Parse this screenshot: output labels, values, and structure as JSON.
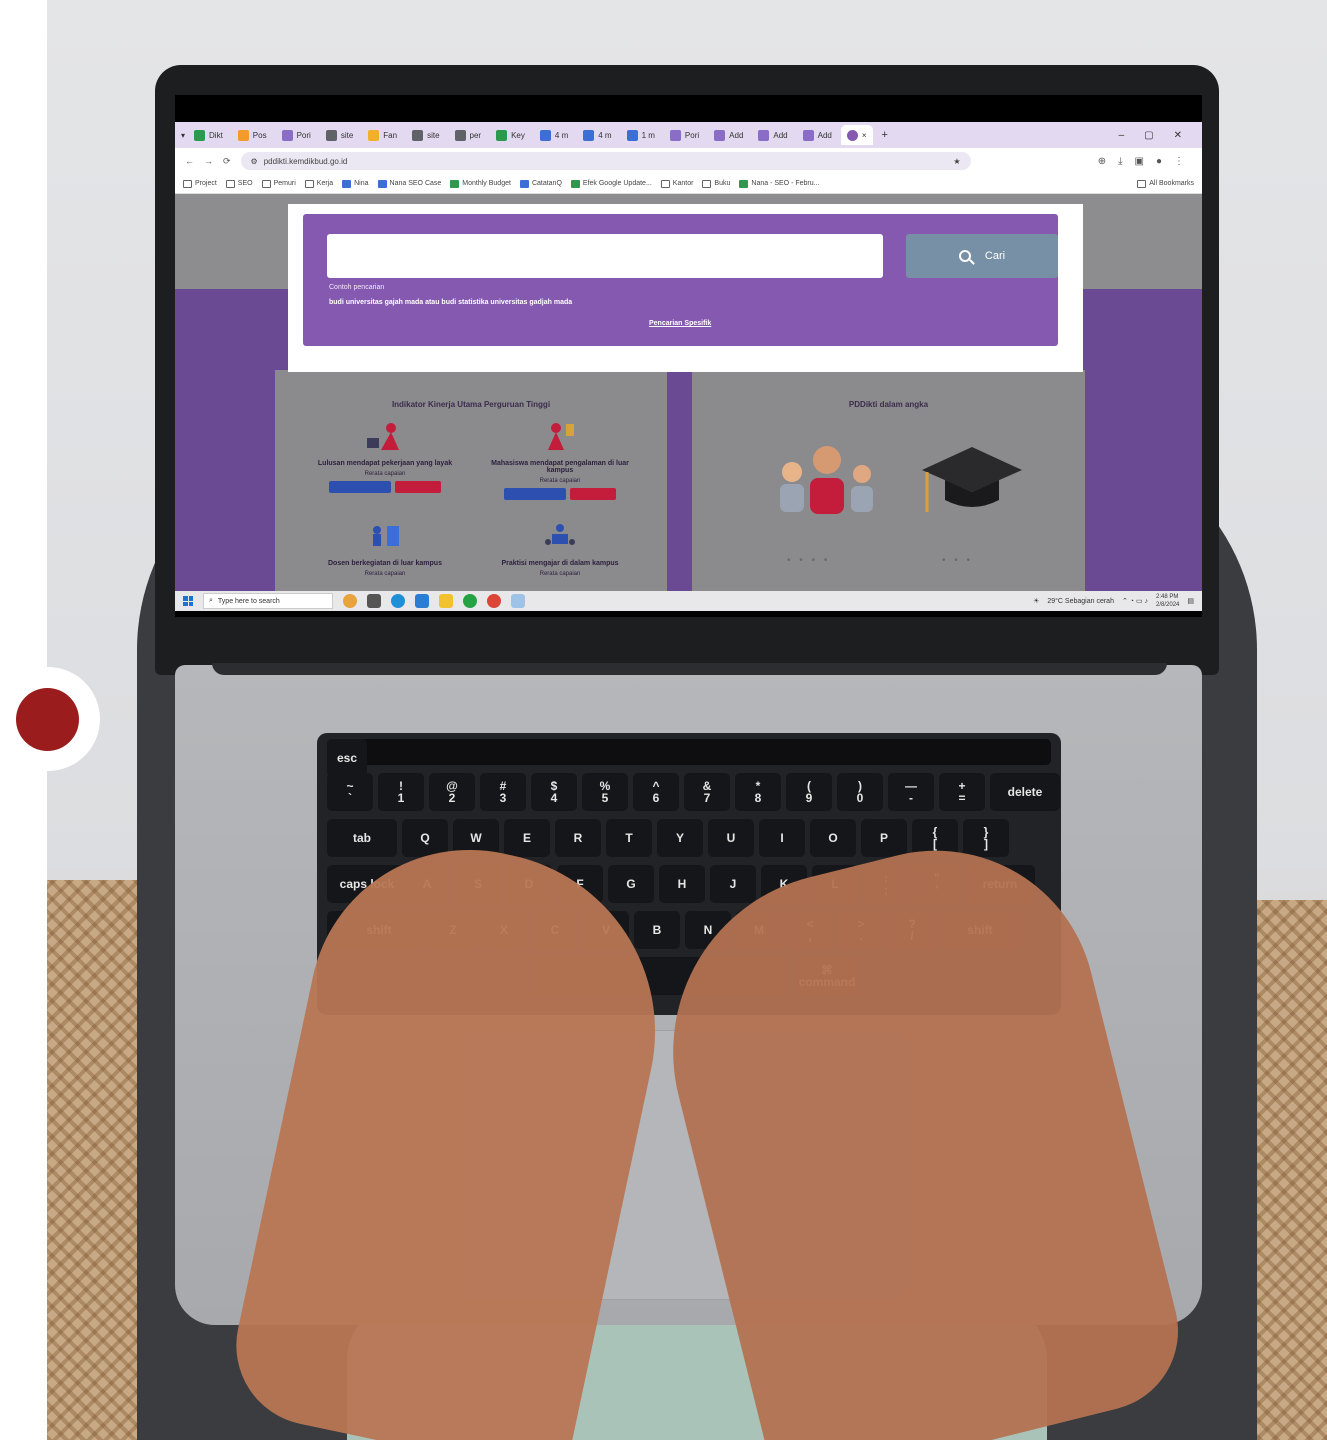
{
  "browser": {
    "tabs": [
      {
        "label": "Dikt",
        "color": "#2c9a4c"
      },
      {
        "label": "Pos",
        "color": "#f29a2a"
      },
      {
        "label": "Pori",
        "color": "#8a6dc6"
      },
      {
        "label": "site",
        "color": "#5f6368"
      },
      {
        "label": "Fan",
        "color": "#f2b02a"
      },
      {
        "label": "site",
        "color": "#5f6368"
      },
      {
        "label": "per",
        "color": "#5f6368"
      },
      {
        "label": "Key",
        "color": "#2c9a4c"
      },
      {
        "label": "4 m",
        "color": "#3b6fd6"
      },
      {
        "label": "4 m",
        "color": "#3b6fd6"
      },
      {
        "label": "1 m",
        "color": "#3b6fd6"
      },
      {
        "label": "Pori",
        "color": "#8a6dc6"
      },
      {
        "label": "Add",
        "color": "#8a6dc6"
      },
      {
        "label": "Add",
        "color": "#8a6dc6"
      },
      {
        "label": "Add",
        "color": "#8a6dc6"
      }
    ],
    "new_tab": "+",
    "close_tab": "×",
    "window_controls": [
      "–",
      "▢",
      "✕"
    ],
    "url": "pddikti.kemdikbud.go.id",
    "bookmarks": [
      "Project",
      "SEO",
      "Pemuri",
      "Kerja",
      "Nina",
      "Nana SEO Case",
      "Monthly Budget",
      "CatatanQ",
      "Efek Google Update...",
      "Kantor",
      "Buku",
      "Nana - SEO - Febru..."
    ],
    "all_bookmarks": "All Bookmarks"
  },
  "search": {
    "placeholder": "",
    "button_label": "Cari",
    "example_label": "Contoh pencarian",
    "example_text": "budi universitas gajah mada atau budi statistika universitas gadjah mada",
    "specific_link": "Pencarian Spesifik"
  },
  "cards": {
    "left_title": "Indikator Kinerja Utama Perguruan Tinggi",
    "right_title": "PDDikti dalam angka",
    "indicators": [
      {
        "title": "Lulusan mendapat pekerjaan yang layak",
        "sub": "Rerata capaian"
      },
      {
        "title": "Mahasiswa mendapat pengalaman di luar kampus",
        "sub": "Rerata capaian"
      },
      {
        "title": "Dosen berkegiatan di luar kampus",
        "sub": "Rerata capaian"
      },
      {
        "title": "Praktisi mengajar di dalam kampus",
        "sub": "Rerata capaian"
      }
    ]
  },
  "taskbar": {
    "search_placeholder": "Type here to search",
    "weather": "29°C  Sebagian cerah",
    "time": "2:48 PM",
    "date": "2/8/2024"
  },
  "keyboard": {
    "row1": [
      "~\n`",
      "!\n1",
      "@\n2",
      "#\n3",
      "$\n4",
      "%\n5",
      "^\n6",
      "&\n7",
      "*\n8",
      "(\n9",
      ")\n0",
      "—\n-",
      "+\n="
    ],
    "row2": [
      "tab",
      "Q",
      "W",
      "E",
      "R",
      "T",
      "Y",
      "U",
      "I",
      "O",
      "P",
      "{\n[",
      "}\n]"
    ],
    "row3": [
      "caps lock",
      "A",
      "S",
      "D",
      "F",
      "G",
      "H",
      "J",
      "K",
      "L",
      ":\n;",
      "\"\n'",
      "return"
    ],
    "row4": [
      "shift",
      "Z",
      "X",
      "C",
      "V",
      "B",
      "N",
      "M",
      "<\n,",
      ">\n.",
      "?\n/",
      "shift"
    ],
    "esc": "esc",
    "delete": "delete",
    "command": "⌘\ncommand"
  },
  "decor": {
    "accent": "#9b1c1c",
    "page_purple": "#8659b0"
  }
}
